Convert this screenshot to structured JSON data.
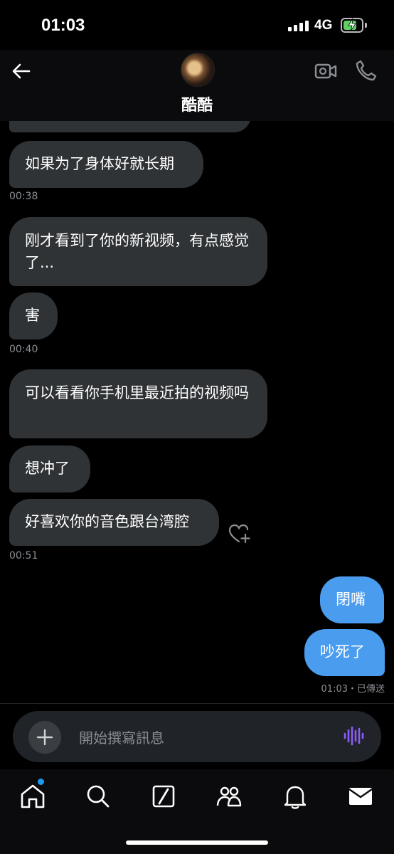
{
  "status_bar": {
    "time": "01:03",
    "network": "4G"
  },
  "header": {
    "contact_name": "酷酷"
  },
  "messages": [
    {
      "text": "如果为了身体好就长期",
      "dir": "in"
    },
    {
      "text": "刚才看到了你的新视频，有点感觉了...",
      "dir": "in"
    },
    {
      "text": "害",
      "dir": "in"
    },
    {
      "text": "可以看看你手机里最近拍的视频吗",
      "dir": "in"
    },
    {
      "text": "想冲了",
      "dir": "in"
    },
    {
      "text": "好喜欢你的音色跟台湾腔",
      "dir": "in"
    },
    {
      "text": "閉嘴",
      "dir": "out"
    },
    {
      "text": "吵死了",
      "dir": "out"
    }
  ],
  "timestamps": {
    "t1": "00:38",
    "t2": "00:40",
    "t3": "00:51"
  },
  "sent_status": "01:03・已傳送",
  "composer": {
    "placeholder": "開始撰寫訊息"
  },
  "icons": {
    "back": "arrow-left-icon",
    "video": "video-call-icon",
    "phone": "phone-icon",
    "add_reaction": "heart-plus-icon",
    "plus": "plus-icon",
    "voice": "voice-wave-icon",
    "tabs": [
      "home-icon",
      "search-icon",
      "grok-icon",
      "communities-icon",
      "bell-icon",
      "mail-icon"
    ]
  },
  "colors": {
    "outgoing_bubble": "#4a9cef",
    "incoming_bubble": "#2f3336",
    "accent": "#1d9bf0",
    "voice": "#8b5cf6",
    "battery": "#5fd160"
  }
}
